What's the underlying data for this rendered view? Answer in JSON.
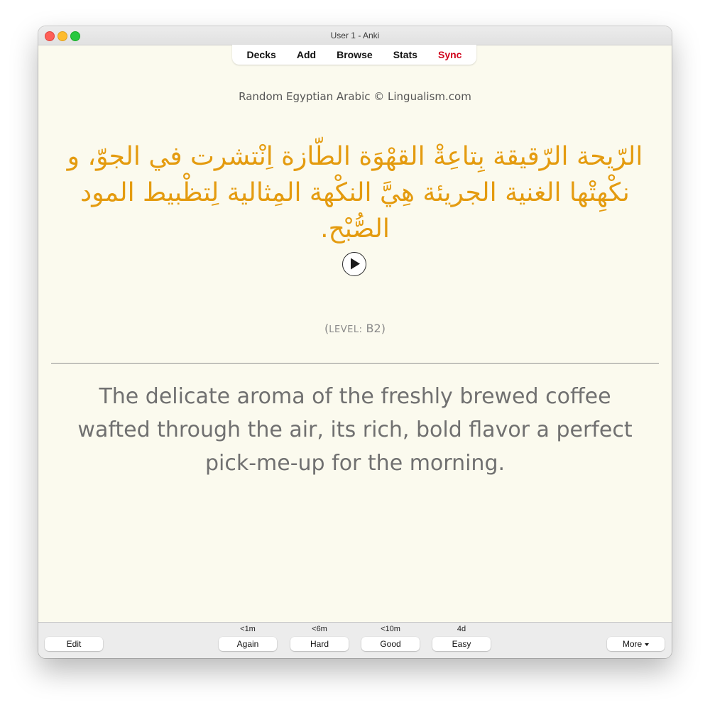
{
  "window": {
    "title": "User 1 - Anki"
  },
  "toolbar": {
    "decks": "Decks",
    "add": "Add",
    "browse": "Browse",
    "stats": "Stats",
    "sync": "Sync"
  },
  "card": {
    "deck_label": "Random Egyptian Arabic © Lingualism.com",
    "arabic_text": "الرّيحة الرّقيقة بِتاعِةْ القهْوَة الطّازة اِنْتشرت في الجوّ، و نكْهِتْها الغنية الجريئة هِيَّ النكْهة المِثالية لِتظْبيط المود الصُّبْح.",
    "level_prefix": "(",
    "level_label": "LEVEL:",
    "level_value": " B2)",
    "english_text": "The delicate aroma of the freshly brewed coffee wafted through the air, its rich, bold flavor a perfect pick-me-up for the morning."
  },
  "bottom": {
    "edit": "Edit",
    "more": "More",
    "answers": [
      {
        "interval": "<1m",
        "label": "Again"
      },
      {
        "interval": "<6m",
        "label": "Hard"
      },
      {
        "interval": "<10m",
        "label": "Good"
      },
      {
        "interval": "4d",
        "label": "Easy"
      }
    ]
  },
  "colors": {
    "arabic_text": "#e49b0f",
    "sync": "#d0021b",
    "card_background": "#fbfaee"
  },
  "icons": {
    "play": "play-icon",
    "dropdown": "caret-down-icon"
  }
}
